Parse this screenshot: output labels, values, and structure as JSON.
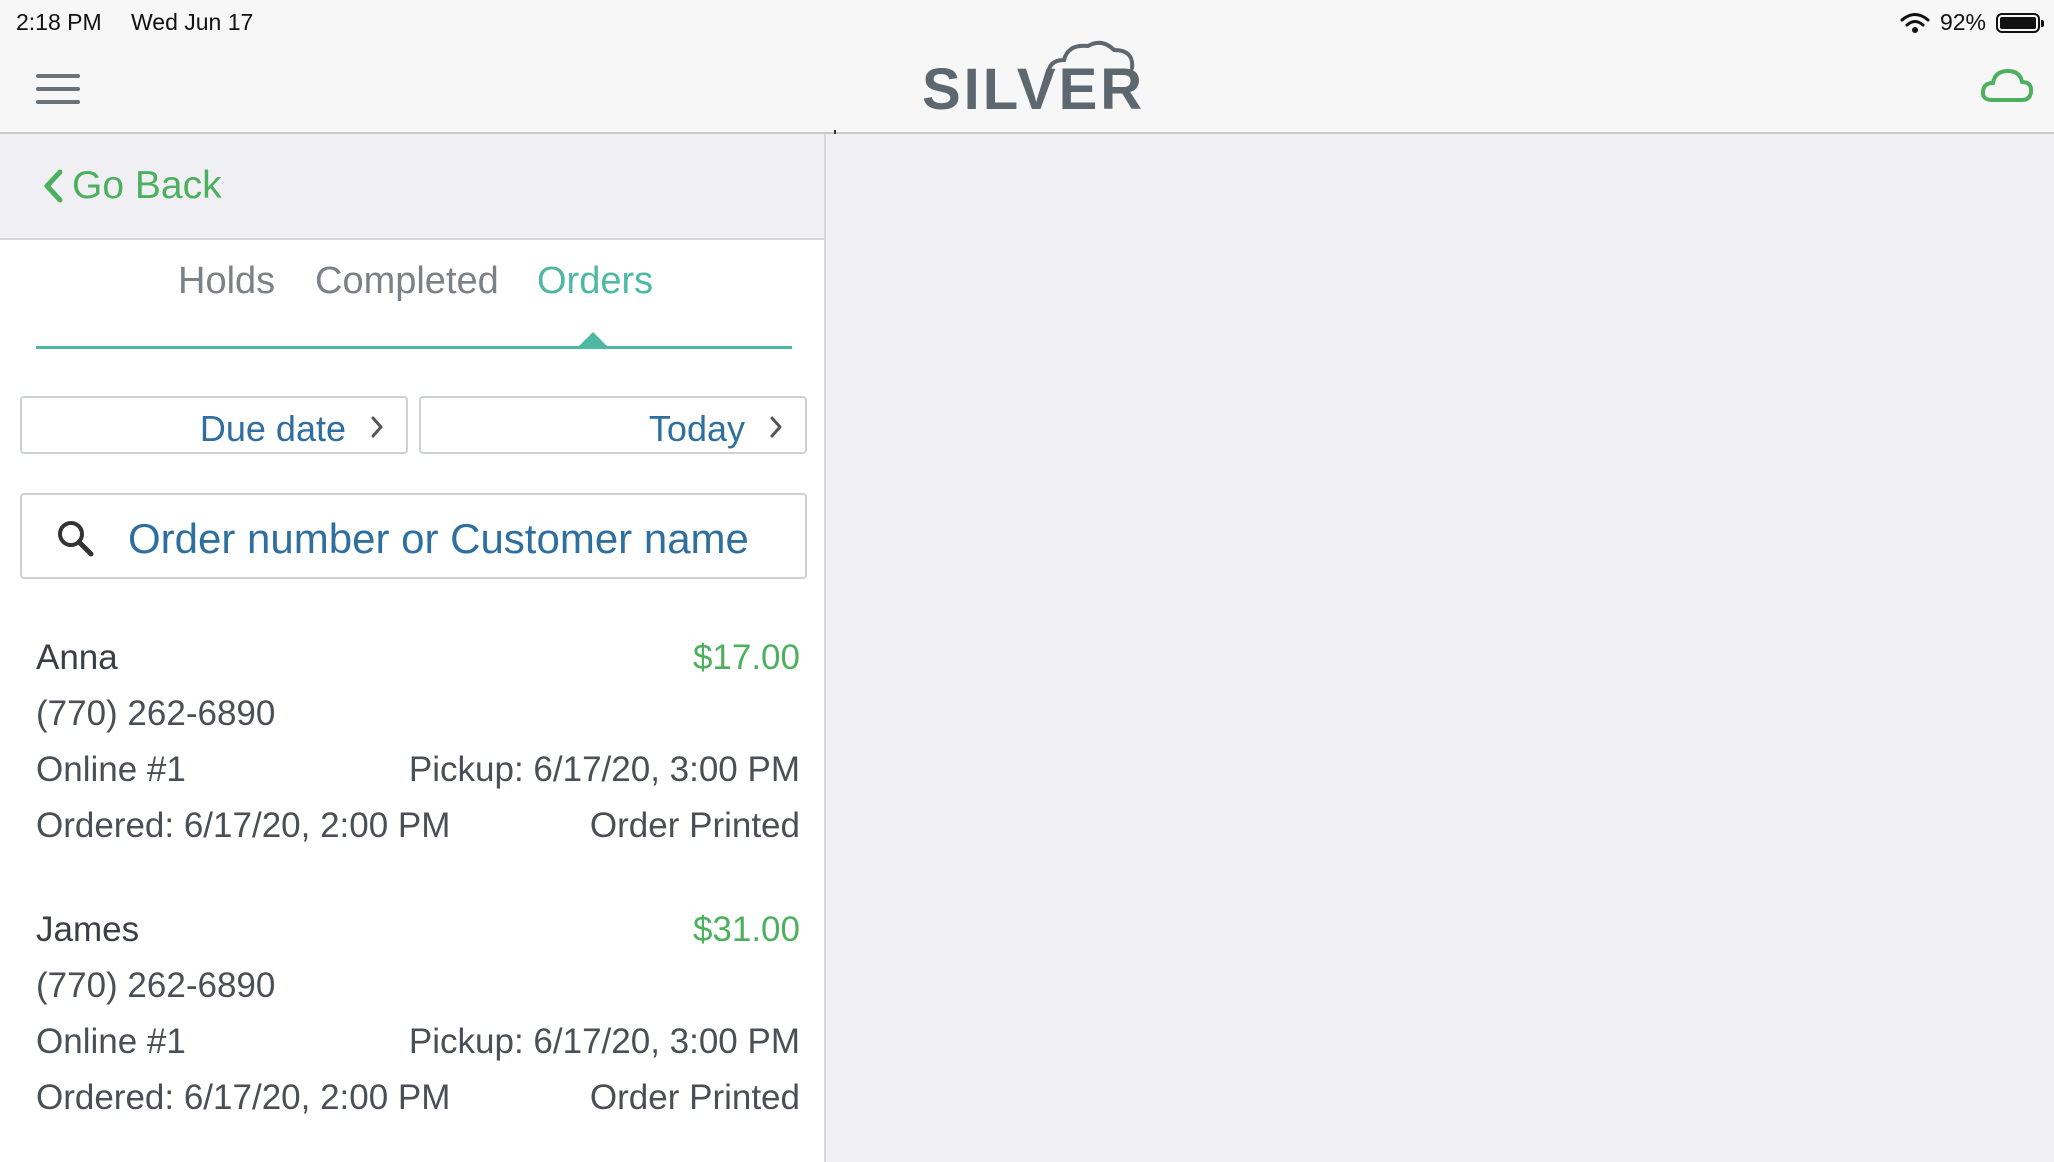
{
  "status_bar": {
    "time": "2:18 PM",
    "date": "Wed Jun 17",
    "battery": "92%"
  },
  "header": {
    "logo": "SILVER",
    "menu_icon": "hamburger-menu-icon",
    "cloud_icon": "cloud-sync-icon"
  },
  "nav": {
    "back_label": "Go Back"
  },
  "tabs": [
    {
      "label": "Holds",
      "active": false
    },
    {
      "label": "Completed",
      "active": false
    },
    {
      "label": "Orders",
      "active": true
    }
  ],
  "filters": {
    "sort_label": "Due date",
    "range_label": "Today"
  },
  "search": {
    "placeholder": "Order number or Customer name"
  },
  "orders": [
    {
      "name": "Anna",
      "amount": "$17.00",
      "phone": "(770) 262-6890",
      "source": "Online #1",
      "pickup": "Pickup: 6/17/20, 3:00 PM",
      "ordered": "Ordered: 6/17/20, 2:00 PM",
      "status": "Order Printed"
    },
    {
      "name": "James",
      "amount": "$31.00",
      "phone": "(770) 262-6890",
      "source": "Online #1",
      "pickup": "Pickup: 6/17/20, 3:00 PM",
      "ordered": "Ordered: 6/17/20, 2:00 PM",
      "status": "Order Printed"
    }
  ],
  "colors": {
    "accent_green": "#4cb05e",
    "tab_teal": "#4db9a4",
    "link_blue": "#2f6f9f"
  }
}
